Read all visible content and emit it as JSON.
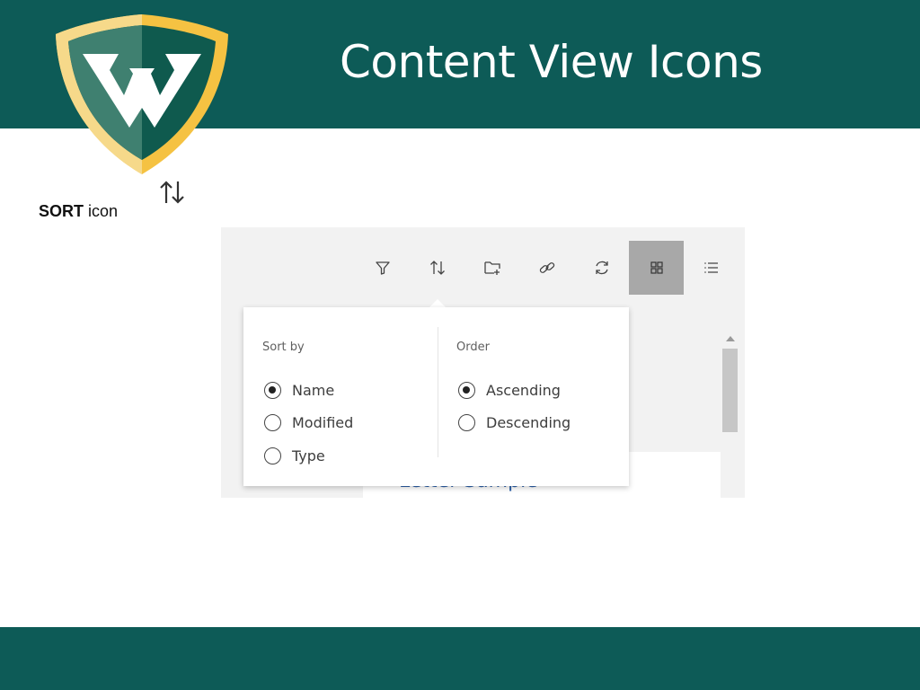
{
  "slide": {
    "title": "Content View Icons",
    "caption_bold": "SORT",
    "caption_rest": " icon",
    "colors": {
      "band": "#0d5b57",
      "shield_gold": "#f5c242",
      "shield_green": "#0f5a4e",
      "link_blue": "#2a5fa8",
      "active_button": "#a8a8a8"
    }
  },
  "toolbar": {
    "buttons": [
      {
        "name": "filter",
        "icon": "filter-icon",
        "active": false
      },
      {
        "name": "sort",
        "icon": "sort-icon",
        "active": false
      },
      {
        "name": "new-folder",
        "icon": "folder-add-icon",
        "active": false
      },
      {
        "name": "link",
        "icon": "link-icon",
        "active": false
      },
      {
        "name": "refresh",
        "icon": "refresh-icon",
        "active": false
      },
      {
        "name": "grid-view",
        "icon": "grid-icon",
        "active": true
      },
      {
        "name": "list-view",
        "icon": "list-icon",
        "active": false
      }
    ]
  },
  "sort_popover": {
    "sort_by": {
      "heading": "Sort by",
      "options": [
        {
          "label": "Name",
          "checked": true
        },
        {
          "label": "Modified",
          "checked": false
        },
        {
          "label": "Type",
          "checked": false
        }
      ]
    },
    "order": {
      "heading": "Order",
      "options": [
        {
          "label": "Ascending",
          "checked": true
        },
        {
          "label": "Descending",
          "checked": false
        }
      ]
    }
  },
  "content": {
    "visible_item": "Letter Sample"
  }
}
